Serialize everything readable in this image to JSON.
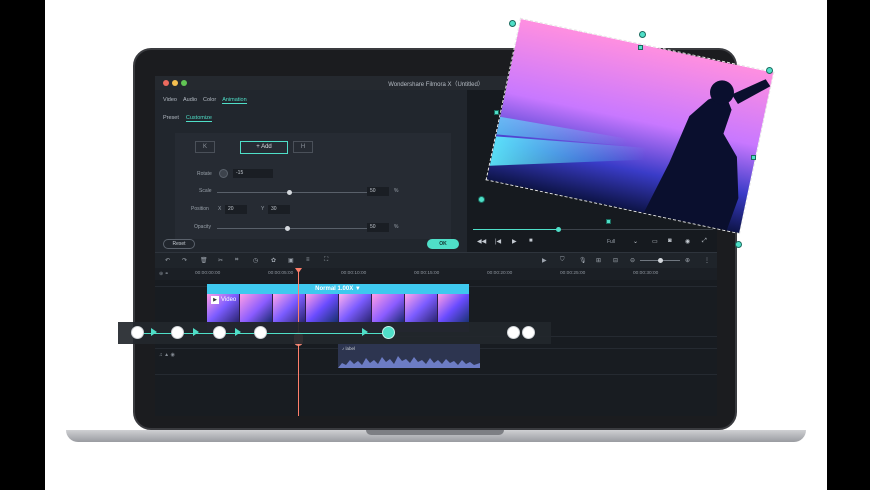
{
  "window": {
    "title": "Wondershare Filmora X（Untitled）"
  },
  "panel": {
    "tabs": [
      "Video",
      "Audio",
      "Color",
      "Animation"
    ],
    "active_tab": "Animation",
    "subtabs": [
      "Preset",
      "Customize"
    ],
    "active_subtab": "Customize",
    "prev_keyframe": "K",
    "add_label": "+ Add",
    "next_keyframe": "H",
    "rotate_label": "Rotate",
    "rotate_value": "-15",
    "scale_label": "Scale",
    "scale_value": "50",
    "scale_unit": "%",
    "position_label": "Position",
    "pos_x_label": "X",
    "pos_x": "20",
    "pos_y_label": "Y",
    "pos_y": "30",
    "opacity_label": "Opacity",
    "opacity_value": "50",
    "opacity_unit": "%",
    "reset_label": "Reset",
    "ok_label": "OK"
  },
  "preview": {
    "quality": "Full",
    "progress": 0.36
  },
  "timeline": {
    "timecodes": [
      "00:00:00:00",
      "00:00:05:00",
      "00:00:10:00",
      "00:00:15:00",
      "00:00:20:00",
      "00:00:25:00",
      "00:00:30:00"
    ],
    "clip_header": "Normal 1.00X",
    "clip_name": "Video",
    "audio_name": "label"
  },
  "colors": {
    "accent": "#4fdfc8",
    "clip_header": "#3ec8ee",
    "playhead": "#ff7f6b"
  }
}
